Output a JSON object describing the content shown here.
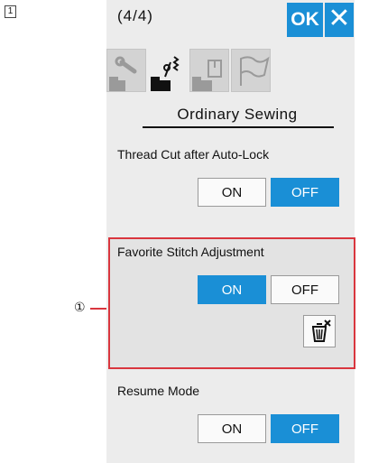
{
  "step_badge": "1",
  "header": {
    "page_counter": "(4/4)",
    "ok_label": "OK",
    "close_label": "✕"
  },
  "tabs": [
    {
      "icon": "wrench-machine-icon"
    },
    {
      "icon": "sewing-stitch-icon",
      "active": true
    },
    {
      "icon": "document-machine-icon"
    },
    {
      "icon": "flag-icon"
    }
  ],
  "mode_title": "Ordinary Sewing",
  "settings": {
    "thread_cut": {
      "label": "Thread Cut after Auto-Lock",
      "on_label": "ON",
      "off_label": "OFF",
      "selected": "OFF"
    },
    "favorite": {
      "label": "Favorite Stitch Adjustment",
      "on_label": "ON",
      "off_label": "OFF",
      "selected": "ON",
      "delete_icon": "trash-icon"
    },
    "resume": {
      "label": "Resume Mode",
      "on_label": "ON",
      "off_label": "OFF",
      "selected": "OFF"
    }
  },
  "callout_marker": "①",
  "colors": {
    "accent": "#1a8fd6",
    "highlight": "#d9363e"
  }
}
